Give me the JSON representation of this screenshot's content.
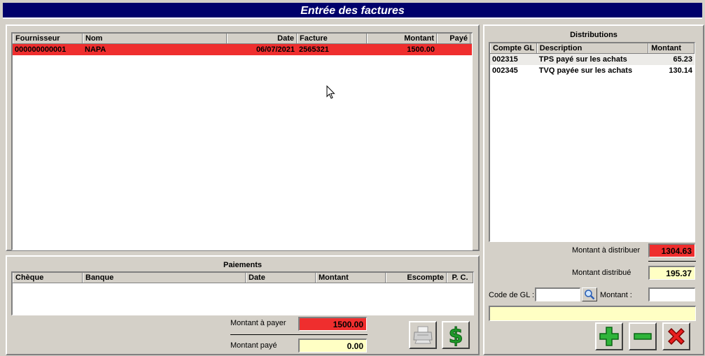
{
  "window_title": "Entrée des factures",
  "invoices": {
    "columns": [
      "Fournisseur",
      "Nom",
      "Date",
      "Facture",
      "Montant",
      "Payé"
    ],
    "rows": [
      {
        "fournisseur": "000000000001",
        "nom": "NAPA",
        "date": "06/07/2021",
        "facture": "2565321",
        "montant": "1500.00",
        "paye": ""
      }
    ]
  },
  "payments": {
    "title": "Paiements",
    "columns": [
      "Chèque",
      "Banque",
      "Date",
      "Montant",
      "Escompte",
      "P. C."
    ],
    "montant_a_payer_label": "Montant à payer",
    "montant_a_payer": "1500.00",
    "montant_paye_label": "Montant payé",
    "montant_paye": "0.00"
  },
  "distributions": {
    "title": "Distributions",
    "columns": [
      "Compte GL",
      "Description",
      "Montant"
    ],
    "rows": [
      {
        "compte": "002315",
        "description": "TPS payé sur les achats",
        "montant": "65.23"
      },
      {
        "compte": "002345",
        "description": "TVQ payée sur les achats",
        "montant": "130.14"
      }
    ],
    "montant_a_distribuer_label": "Montant à distribuer",
    "montant_a_distribuer": "1304.63",
    "montant_distribue_label": "Montant distribué",
    "montant_distribue": "195.37",
    "code_gl_label": "Code de GL :",
    "code_gl_value": "",
    "montant_label": "Montant :",
    "montant_value": ""
  },
  "colors": {
    "title_bg": "#00006b",
    "selected_row": "#ef2e2e",
    "highlight_field": "#ffffc4"
  },
  "icons": [
    "printer-icon",
    "dollar-icon",
    "search-icon",
    "add-icon",
    "remove-icon",
    "delete-icon",
    "cursor-icon"
  ]
}
